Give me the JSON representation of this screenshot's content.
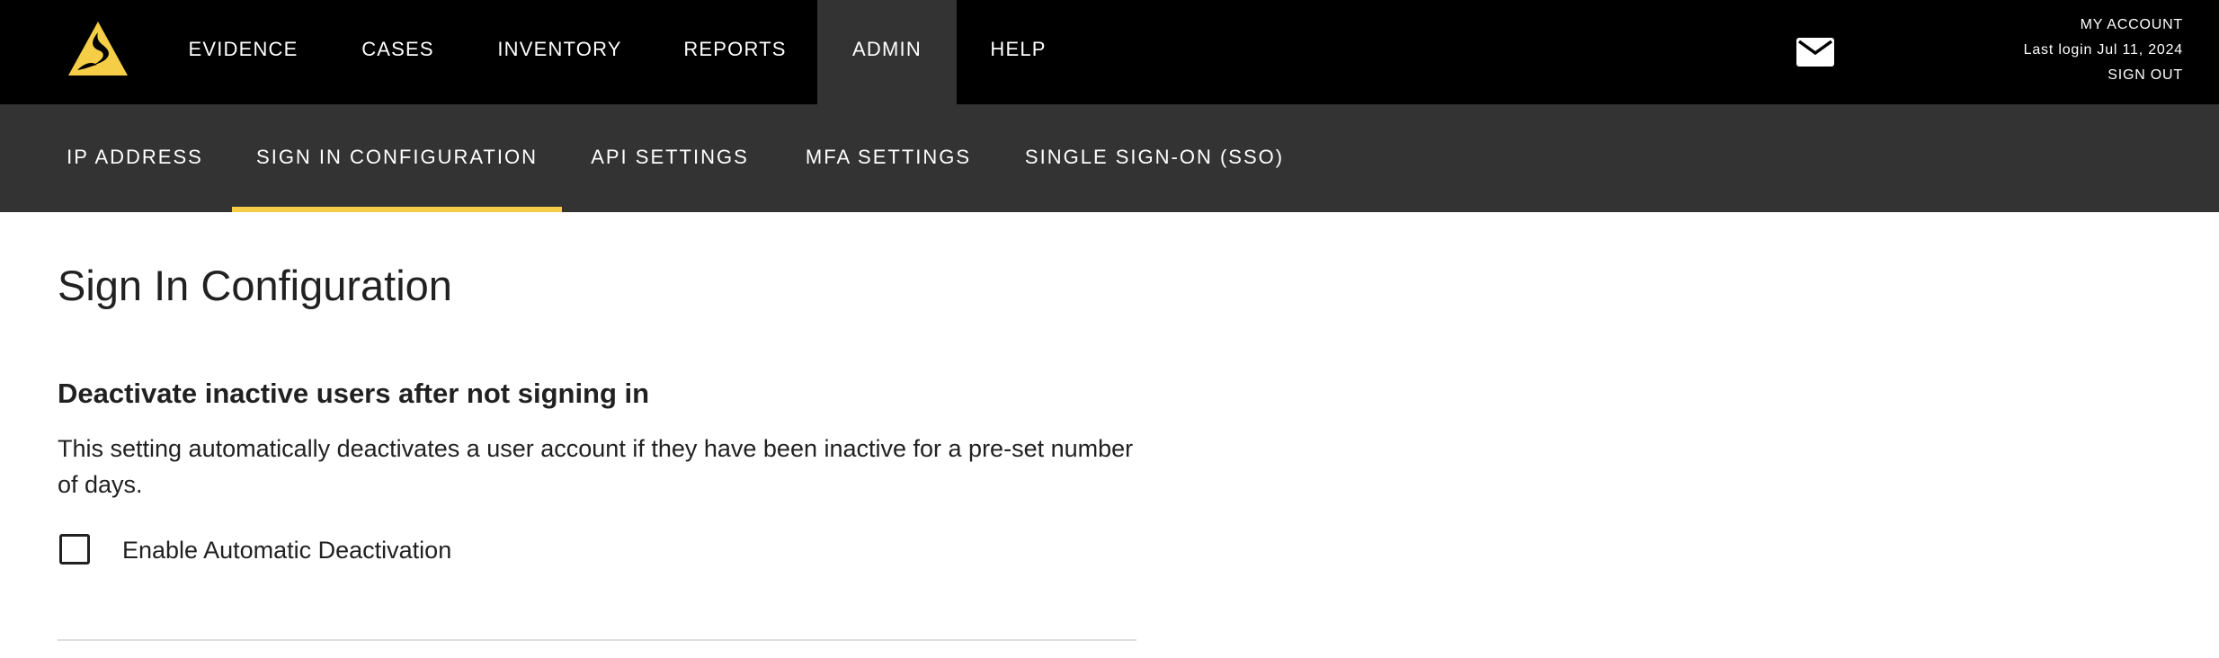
{
  "topnav": {
    "items": [
      {
        "label": "EVIDENCE"
      },
      {
        "label": "CASES"
      },
      {
        "label": "INVENTORY"
      },
      {
        "label": "REPORTS"
      },
      {
        "label": "ADMIN",
        "active": true
      },
      {
        "label": "HELP"
      }
    ],
    "icons": {
      "logo": "brand-logo",
      "mail": "mail-icon"
    },
    "account": {
      "my_account": "MY ACCOUNT",
      "last_login": "Last login Jul 11, 2024",
      "sign_out": "SIGN OUT"
    }
  },
  "subnav": {
    "items": [
      {
        "label": "IP ADDRESS"
      },
      {
        "label": "SIGN IN CONFIGURATION",
        "active": true
      },
      {
        "label": "API SETTINGS"
      },
      {
        "label": "MFA SETTINGS"
      },
      {
        "label": "SINGLE SIGN-ON (SSO)"
      }
    ],
    "indicator_color": "#f5cd47"
  },
  "main": {
    "title": "Sign In Configuration",
    "section": {
      "title": "Deactivate inactive users after not signing in",
      "description": "This setting automatically deactivates a user account if they have been inactive for a pre-set number of days.",
      "checkbox_label": "Enable Automatic Deactivation",
      "checkbox_checked": false
    }
  },
  "colors": {
    "topbar": "#000000",
    "subbar": "#333333",
    "active_tab": "#333333",
    "accent": "#f5cd47",
    "text": "#212121"
  }
}
